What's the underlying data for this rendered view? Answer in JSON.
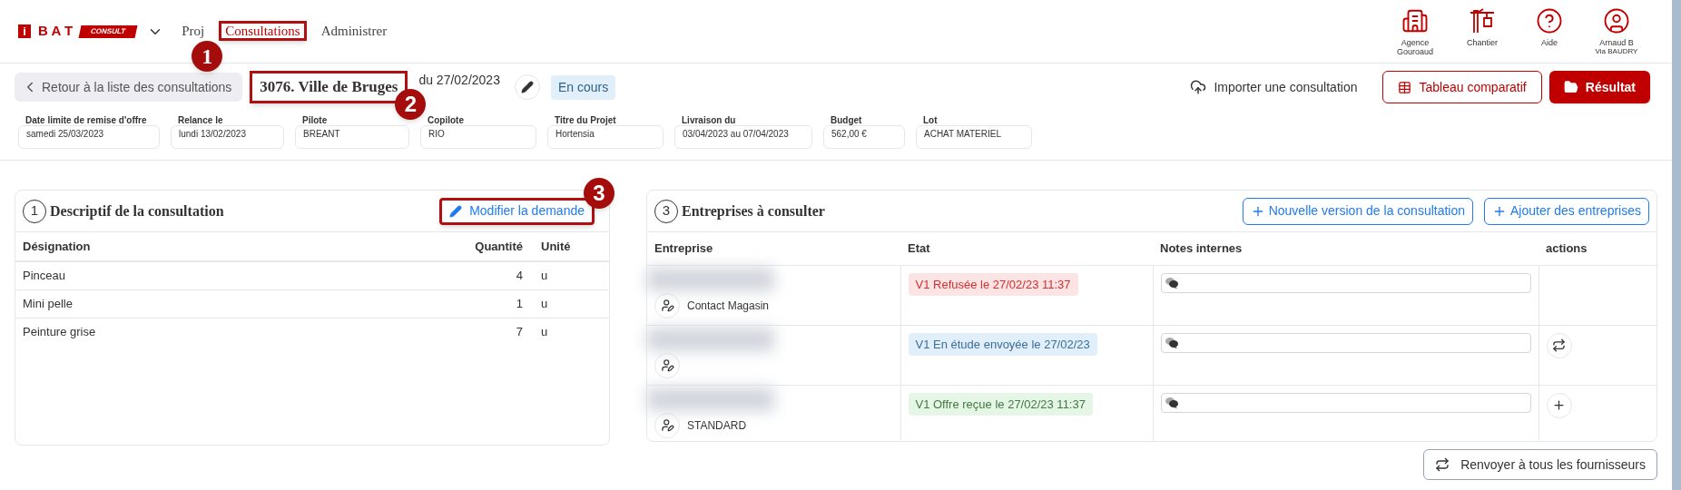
{
  "logo": {
    "mark": "i",
    "name": "B A T",
    "badge": "CONSULT"
  },
  "nav": [
    {
      "label": "Proj",
      "selected": false
    },
    {
      "label": "Consultations",
      "selected": true,
      "callout": "1"
    },
    {
      "label": "Administrer",
      "selected": false
    }
  ],
  "shortcuts": [
    {
      "kind": "building",
      "label": "Agence Gouroaud"
    },
    {
      "kind": "crane",
      "label": "Chantier"
    },
    {
      "kind": "help",
      "label": "Aide"
    },
    {
      "kind": "user",
      "label": "Arnaud B",
      "sublabel": "Via BAUDRY"
    }
  ],
  "consultation": {
    "back": "Retour à la liste des consultations",
    "title": "3076. Ville de Bruges",
    "title_callout": "2",
    "date": "du 27/02/2023",
    "status": "En cours"
  },
  "actions": [
    {
      "kind": "link",
      "label": "Importer une consultation"
    },
    {
      "kind": "outline",
      "label": "Tableau comparatif"
    },
    {
      "kind": "primary",
      "label": "Résultat"
    }
  ],
  "info": [
    {
      "label": "Date limite de remise d'offre",
      "value": "samedi 25/03/2023"
    },
    {
      "label": "Relance le",
      "value": "lundi 13/02/2023"
    },
    {
      "label": "Pilote",
      "value": "BREANT"
    },
    {
      "label": "Copilote",
      "value": "RIO"
    },
    {
      "label": "Titre du Projet",
      "value": "Hortensia"
    },
    {
      "label": "Livraison du",
      "value": "03/04/2023 au 07/04/2023"
    },
    {
      "label": "Budget",
      "value": "562,00 €"
    },
    {
      "label": "Lot",
      "value": "ACHAT MATERIEL"
    }
  ],
  "descriptif": {
    "step": "1",
    "title": "Descriptif de la consultation",
    "edit_button": "Modifier la demande",
    "edit_callout": "3",
    "columns": [
      "Désignation",
      "Quantité",
      "Unité"
    ],
    "rows": [
      [
        "Pinceau",
        "4",
        "u"
      ],
      [
        "Mini pelle",
        "1",
        "u"
      ],
      [
        "Peinture grise",
        "7",
        "u"
      ]
    ]
  },
  "entreprises": {
    "step": "3",
    "title": "Entreprises à consulter",
    "buttons": [
      "Nouvelle version de la consultation",
      "Ajouter des entreprises"
    ],
    "columns": [
      "Entreprise",
      "Etat",
      "Notes internes",
      "actions"
    ],
    "rows": [
      {
        "contact": "Contact Magasin",
        "state": {
          "kind": "refused",
          "label": "V1 Refusée le 27/02/23 11:37"
        },
        "action": {
          "kind": "none"
        }
      },
      {
        "state": {
          "kind": "study",
          "label": "V1 En étude envoyée le 27/02/23"
        },
        "action": {
          "kind": "resend"
        }
      },
      {
        "contact": "STANDARD",
        "state": {
          "kind": "received",
          "label": "V1 Offre reçue le 27/02/23 11:37"
        },
        "action": {
          "kind": "add"
        }
      }
    ],
    "resend_all": "Renvoyer à tous les fournisseurs"
  }
}
